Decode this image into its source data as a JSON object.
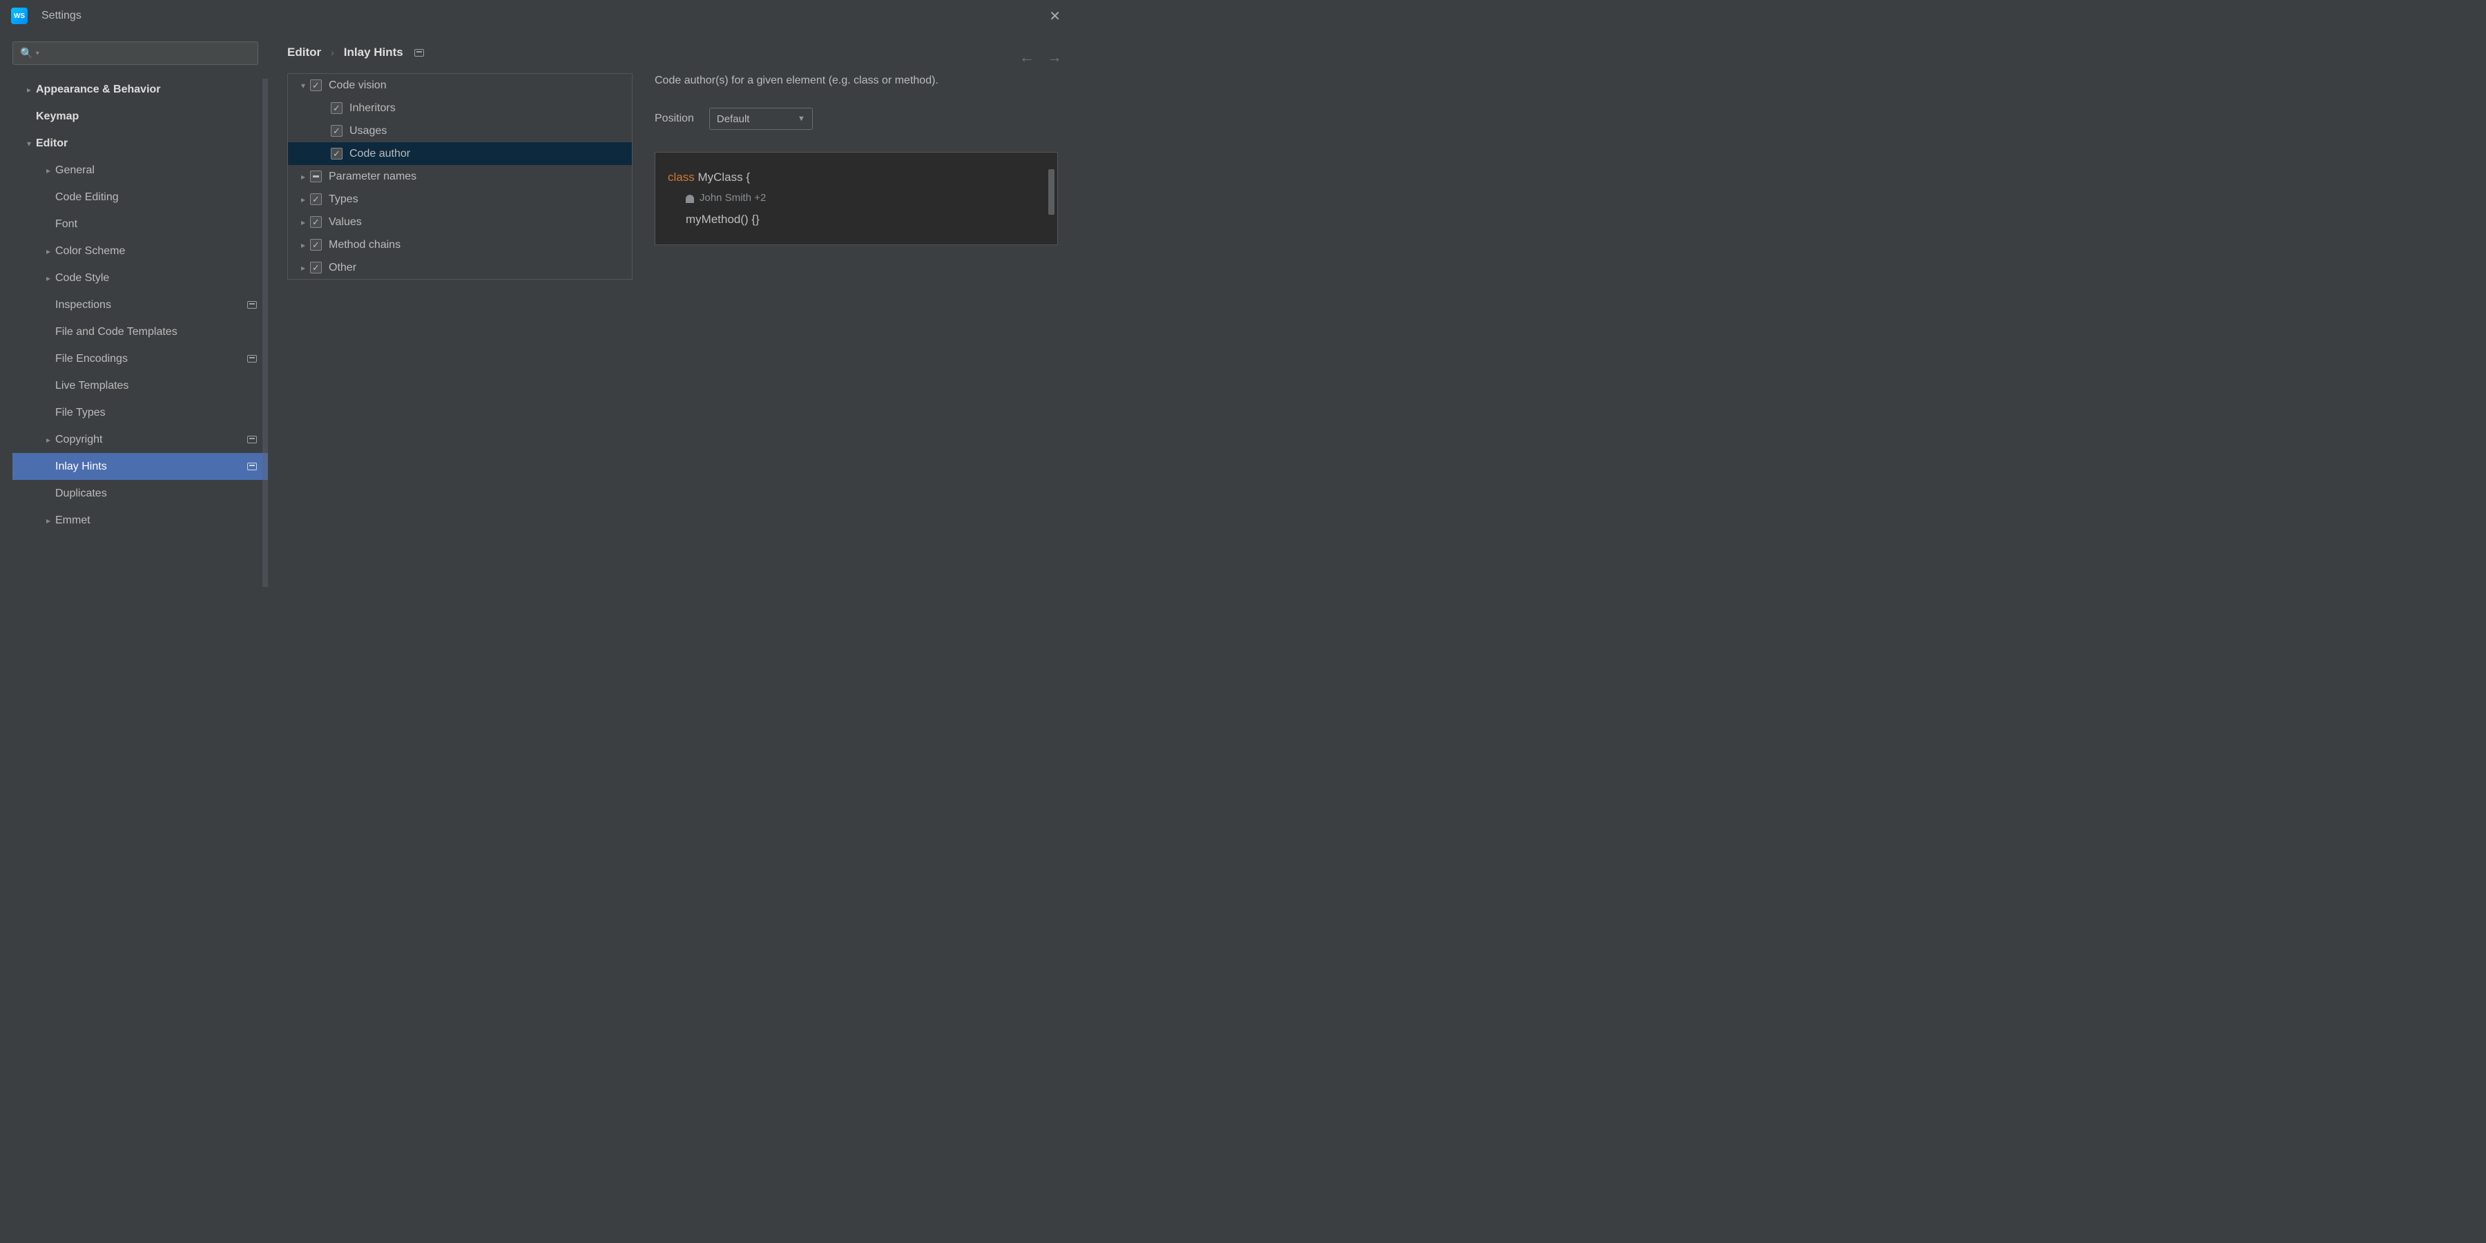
{
  "window": {
    "title": "Settings",
    "app_icon_label": "WS"
  },
  "sidebar": {
    "items": [
      {
        "label": "Appearance & Behavior",
        "bold": true,
        "arrow": "right",
        "indent": 0,
        "badge": false
      },
      {
        "label": "Keymap",
        "bold": true,
        "arrow": "",
        "indent": 0,
        "badge": false
      },
      {
        "label": "Editor",
        "bold": true,
        "arrow": "down",
        "indent": 0,
        "badge": false
      },
      {
        "label": "General",
        "bold": false,
        "arrow": "right",
        "indent": 1,
        "badge": false
      },
      {
        "label": "Code Editing",
        "bold": false,
        "arrow": "",
        "indent": 1,
        "badge": false
      },
      {
        "label": "Font",
        "bold": false,
        "arrow": "",
        "indent": 1,
        "badge": false
      },
      {
        "label": "Color Scheme",
        "bold": false,
        "arrow": "right",
        "indent": 1,
        "badge": false
      },
      {
        "label": "Code Style",
        "bold": false,
        "arrow": "right",
        "indent": 1,
        "badge": false
      },
      {
        "label": "Inspections",
        "bold": false,
        "arrow": "",
        "indent": 1,
        "badge": true
      },
      {
        "label": "File and Code Templates",
        "bold": false,
        "arrow": "",
        "indent": 1,
        "badge": false
      },
      {
        "label": "File Encodings",
        "bold": false,
        "arrow": "",
        "indent": 1,
        "badge": true
      },
      {
        "label": "Live Templates",
        "bold": false,
        "arrow": "",
        "indent": 1,
        "badge": false
      },
      {
        "label": "File Types",
        "bold": false,
        "arrow": "",
        "indent": 1,
        "badge": false
      },
      {
        "label": "Copyright",
        "bold": false,
        "arrow": "right",
        "indent": 1,
        "badge": true
      },
      {
        "label": "Inlay Hints",
        "bold": false,
        "arrow": "",
        "indent": 1,
        "badge": true,
        "selected": true
      },
      {
        "label": "Duplicates",
        "bold": false,
        "arrow": "",
        "indent": 1,
        "badge": false
      },
      {
        "label": "Emmet",
        "bold": false,
        "arrow": "right",
        "indent": 1,
        "badge": false
      }
    ]
  },
  "breadcrumb": {
    "part1": "Editor",
    "part2": "Inlay Hints"
  },
  "tree": [
    {
      "label": "Code vision",
      "arrow": "down",
      "check": "checked",
      "indent": 0
    },
    {
      "label": "Inheritors",
      "arrow": "",
      "check": "checked",
      "indent": 2
    },
    {
      "label": "Usages",
      "arrow": "",
      "check": "checked",
      "indent": 2
    },
    {
      "label": "Code author",
      "arrow": "",
      "check": "checked",
      "indent": 2,
      "selected": true
    },
    {
      "label": "Parameter names",
      "arrow": "right",
      "check": "mixed",
      "indent": 0
    },
    {
      "label": "Types",
      "arrow": "right",
      "check": "checked",
      "indent": 0
    },
    {
      "label": "Values",
      "arrow": "right",
      "check": "checked",
      "indent": 0
    },
    {
      "label": "Method chains",
      "arrow": "right",
      "check": "checked",
      "indent": 0
    },
    {
      "label": "Other",
      "arrow": "right",
      "check": "checked",
      "indent": 0
    }
  ],
  "detail": {
    "description": "Code author(s) for a given element (e.g. class or method).",
    "position_label": "Position",
    "position_value": "Default"
  },
  "preview": {
    "keyword": "class",
    "classname": "MyClass",
    "brace_open": "{",
    "author": "John Smith +2",
    "method": "myMethod() {}"
  }
}
